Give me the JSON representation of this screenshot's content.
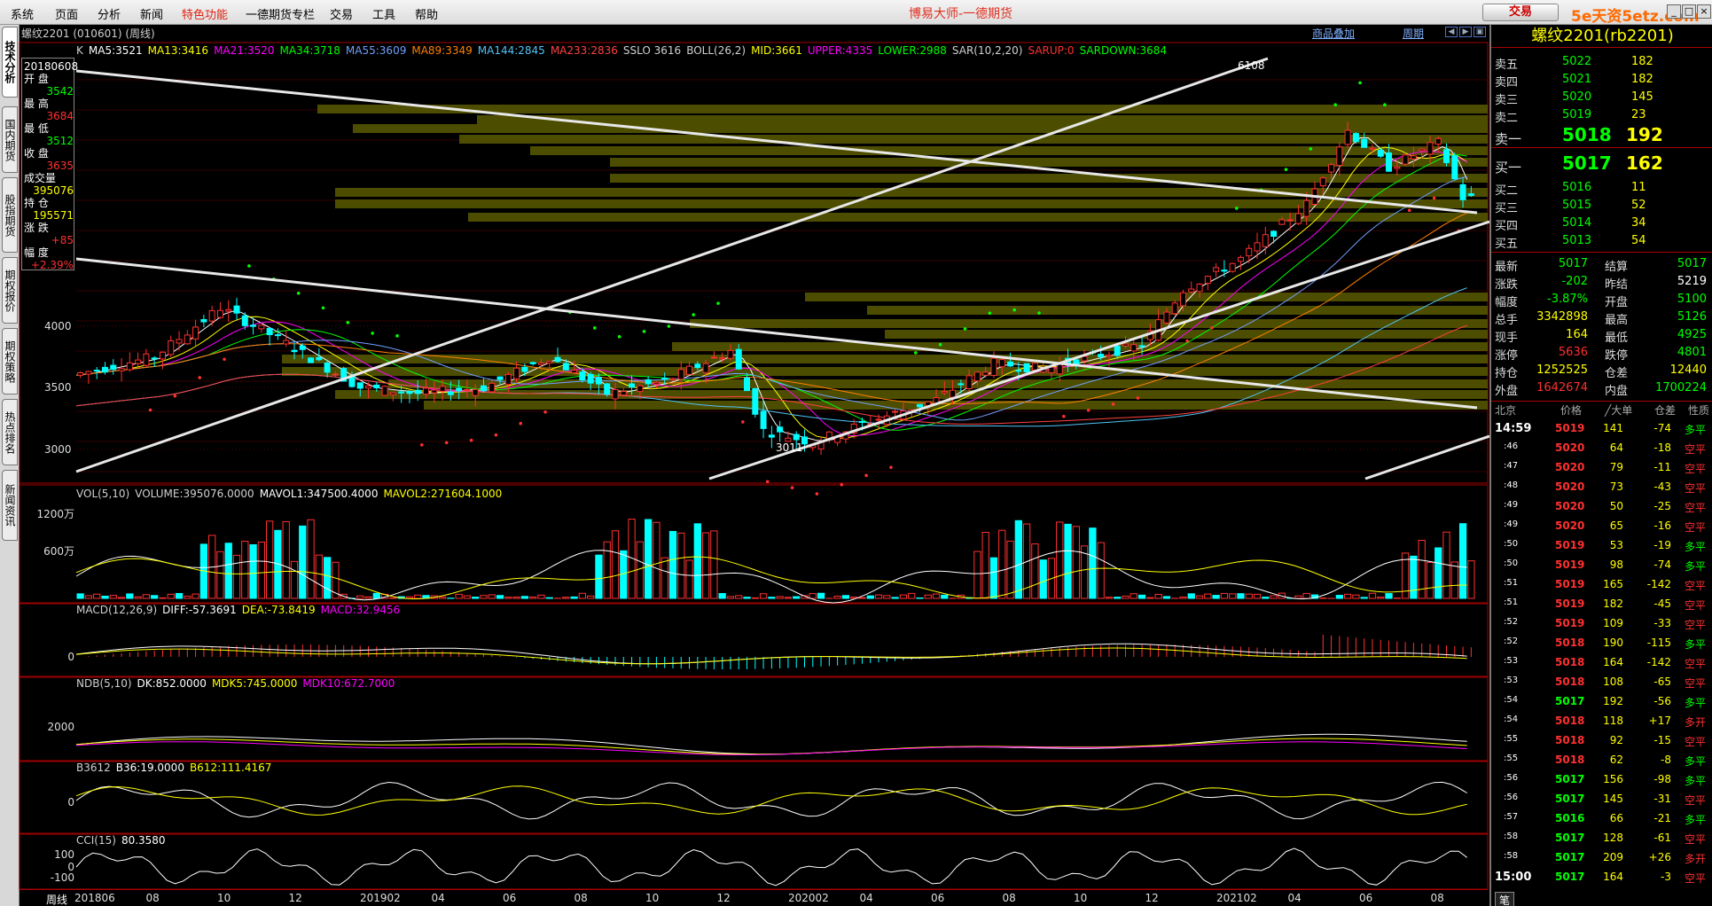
{
  "menu": [
    "系统",
    "页面",
    "分析",
    "新闻",
    "特色功能",
    "一德期货专栏",
    "交易",
    "工具",
    "帮助"
  ],
  "app_title": "博易大师-一德期货",
  "trade_button": "交易",
  "logo_text": "5e天资5etz.com",
  "window_controls": [
    "_",
    "□",
    "×"
  ],
  "left_tabs": [
    "技术分析",
    "国内期货",
    "股指期货",
    "期权报价",
    "期权策略",
    "热点排名",
    "新闻资讯"
  ],
  "contract_line": "螺纹2201 (010601) (周线)",
  "top_links": [
    "商品叠加",
    "周期"
  ],
  "main_indicator": [
    {
      "text": "K",
      "color": "#d0d0d0"
    },
    {
      "text": "MA5:3521",
      "color": "#ffffff"
    },
    {
      "text": "MA13:3416",
      "color": "#ffff00"
    },
    {
      "text": "MA21:3520",
      "color": "#ff00ff"
    },
    {
      "text": "MA34:3718",
      "color": "#00ff00"
    },
    {
      "text": "MA55:3609",
      "color": "#6f9fff"
    },
    {
      "text": "MA89:3349",
      "color": "#ff8000"
    },
    {
      "text": "MA144:2845",
      "color": "#4fc3f7"
    },
    {
      "text": "MA233:2836",
      "color": "#ff4040"
    },
    {
      "text": "SSLO 3616",
      "color": "#d0d0d0"
    },
    {
      "text": "BOLL(26,2)",
      "color": "#d0d0d0"
    },
    {
      "text": "MID:3661",
      "color": "#ffff00"
    },
    {
      "text": "UPPER:4335",
      "color": "#ff00ff"
    },
    {
      "text": "LOWER:2988",
      "color": "#00ff00"
    },
    {
      "text": "SAR(10,2,20)",
      "color": "#d0d0d0"
    },
    {
      "text": "SARUP:0",
      "color": "#ff3030"
    },
    {
      "text": "SARDOWN:3684",
      "color": "#00ff00"
    }
  ],
  "infobox": {
    "date": "20180608",
    "rows": [
      {
        "label": "开 盘",
        "value": "3542",
        "color": "#00ff00"
      },
      {
        "label": "最 高",
        "value": "3684",
        "color": "#ff3030"
      },
      {
        "label": "最 低",
        "value": "3512",
        "color": "#00ff00"
      },
      {
        "label": "收 盘",
        "value": "3635",
        "color": "#ff3030"
      },
      {
        "label": "成交量",
        "value": "395076",
        "color": "#ffff00"
      },
      {
        "label": "持 仓",
        "value": "195571",
        "color": "#ffff00"
      },
      {
        "label": "涨 跌",
        "value": "+85",
        "color": "#ff3030"
      },
      {
        "label": "幅 度",
        "value": "+2.39%",
        "color": "#ff3030"
      }
    ]
  },
  "price_axis": [
    "4000",
    "3500",
    "3000"
  ],
  "price_annotations": {
    "high": "6108",
    "low": "3011"
  },
  "vol_panel": {
    "header": [
      {
        "text": "VOL(5,10)",
        "color": "#d0d0d0"
      },
      {
        "text": "VOLUME:395076.0000",
        "color": "#d0d0d0"
      },
      {
        "text": "MAVOL1:347500.4000",
        "color": "#ffffff"
      },
      {
        "text": "MAVOL2:271604.1000",
        "color": "#ffff00"
      }
    ],
    "axis": [
      "1200万",
      "600万"
    ]
  },
  "macd_panel": {
    "header": [
      {
        "text": "MACD(12,26,9)",
        "color": "#d0d0d0"
      },
      {
        "text": "DIFF:-57.3691",
        "color": "#ffffff"
      },
      {
        "text": "DEA:-73.8419",
        "color": "#ffff00"
      },
      {
        "text": "MACD:32.9456",
        "color": "#ff00ff"
      }
    ],
    "axis": [
      "0"
    ]
  },
  "ndb_panel": {
    "header": [
      {
        "text": "NDB(5,10)",
        "color": "#d0d0d0"
      },
      {
        "text": "DK:852.0000",
        "color": "#ffffff"
      },
      {
        "text": "MDK5:745.0000",
        "color": "#ffff00"
      },
      {
        "text": "MDK10:672.7000",
        "color": "#ff00ff"
      }
    ],
    "axis": [
      "2000"
    ]
  },
  "b3612_panel": {
    "header": [
      {
        "text": "B3612",
        "color": "#d0d0d0"
      },
      {
        "text": "B36:19.0000",
        "color": "#ffffff"
      },
      {
        "text": "B612:111.4167",
        "color": "#ffff00"
      }
    ],
    "axis": [
      "0"
    ]
  },
  "cci_panel": {
    "header": [
      {
        "text": "CCI(15)",
        "color": "#d0d0d0"
      },
      {
        "text": "80.3580",
        "color": "#ffffff"
      }
    ],
    "axis": [
      "100",
      "0",
      "-100"
    ]
  },
  "x_axis": {
    "period": "周线",
    "labels": [
      "201806",
      "08",
      "10",
      "12",
      "201902",
      "04",
      "06",
      "08",
      "10",
      "12",
      "202002",
      "04",
      "06",
      "08",
      "10",
      "12",
      "202102",
      "04",
      "06",
      "08"
    ]
  },
  "quote": {
    "title": "螺纹2201(rb2201)",
    "asks": [
      {
        "label": "卖五",
        "price": "5022",
        "vol": "182"
      },
      {
        "label": "卖四",
        "price": "5021",
        "vol": "182"
      },
      {
        "label": "卖三",
        "price": "5020",
        "vol": "145"
      },
      {
        "label": "卖二",
        "price": "5019",
        "vol": "23"
      },
      {
        "label": "卖一",
        "price": "5018",
        "vol": "192"
      }
    ],
    "bids": [
      {
        "label": "买一",
        "price": "5017",
        "vol": "162"
      },
      {
        "label": "买二",
        "price": "5016",
        "vol": "11"
      },
      {
        "label": "买三",
        "price": "5015",
        "vol": "52"
      },
      {
        "label": "买四",
        "price": "5014",
        "vol": "34"
      },
      {
        "label": "买五",
        "price": "5013",
        "vol": "54"
      }
    ],
    "stats": [
      {
        "l1": "最新",
        "v1": "5017",
        "c1": "#00ff00",
        "l2": "结算",
        "v2": "5017",
        "c2": "#00ff00"
      },
      {
        "l1": "涨跌",
        "v1": "-202",
        "c1": "#00ff00",
        "l2": "昨结",
        "v2": "5219",
        "c2": "#ffffff"
      },
      {
        "l1": "幅度",
        "v1": "-3.87%",
        "c1": "#00ff00",
        "l2": "开盘",
        "v2": "5100",
        "c2": "#00ff00"
      },
      {
        "l1": "总手",
        "v1": "3342898",
        "c1": "#ffff00",
        "l2": "最高",
        "v2": "5126",
        "c2": "#00ff00"
      },
      {
        "l1": "现手",
        "v1": "164",
        "c1": "#ffff00",
        "l2": "最低",
        "v2": "4925",
        "c2": "#00ff00"
      },
      {
        "l1": "涨停",
        "v1": "5636",
        "c1": "#ff3030",
        "l2": "跌停",
        "v2": "4801",
        "c2": "#00ff00"
      },
      {
        "l1": "持仓",
        "v1": "1252525",
        "c1": "#ffff00",
        "l2": "仓差",
        "v2": "12440",
        "c2": "#ffff00"
      },
      {
        "l1": "外盘",
        "v1": "1642674",
        "c1": "#ff3030",
        "l2": "内盘",
        "v2": "1700224",
        "c2": "#00ff00"
      }
    ],
    "tick_header": [
      "北京",
      "价格",
      "╱大单",
      "仓差",
      "性质"
    ],
    "ticks": [
      {
        "t": "14:59",
        "p": "5019",
        "v": "141",
        "d": "-74",
        "n": "多平"
      },
      {
        "t": ":46",
        "p": "5020",
        "v": "64",
        "d": "-18",
        "n": "空平"
      },
      {
        "t": ":47",
        "p": "5020",
        "v": "79",
        "d": "-11",
        "n": "空平"
      },
      {
        "t": ":48",
        "p": "5020",
        "v": "73",
        "d": "-43",
        "n": "空平"
      },
      {
        "t": ":49",
        "p": "5020",
        "v": "50",
        "d": "-25",
        "n": "空平"
      },
      {
        "t": ":49",
        "p": "5020",
        "v": "65",
        "d": "-16",
        "n": "空平"
      },
      {
        "t": ":50",
        "p": "5019",
        "v": "53",
        "d": "-19",
        "n": "多平"
      },
      {
        "t": ":50",
        "p": "5019",
        "v": "98",
        "d": "-74",
        "n": "多平"
      },
      {
        "t": ":51",
        "p": "5019",
        "v": "165",
        "d": "-142",
        "n": "空平"
      },
      {
        "t": ":51",
        "p": "5019",
        "v": "182",
        "d": "-45",
        "n": "空平"
      },
      {
        "t": ":52",
        "p": "5019",
        "v": "109",
        "d": "-33",
        "n": "空平"
      },
      {
        "t": ":52",
        "p": "5018",
        "v": "190",
        "d": "-115",
        "n": "多平"
      },
      {
        "t": ":53",
        "p": "5018",
        "v": "164",
        "d": "-142",
        "n": "空平"
      },
      {
        "t": ":53",
        "p": "5018",
        "v": "108",
        "d": "-65",
        "n": "空平"
      },
      {
        "t": ":54",
        "p": "5017",
        "v": "192",
        "d": "-56",
        "n": "多平"
      },
      {
        "t": ":54",
        "p": "5018",
        "v": "118",
        "d": "+17",
        "n": "多开"
      },
      {
        "t": ":55",
        "p": "5018",
        "v": "92",
        "d": "-15",
        "n": "空平"
      },
      {
        "t": ":55",
        "p": "5018",
        "v": "62",
        "d": "-8",
        "n": "多平"
      },
      {
        "t": ":56",
        "p": "5017",
        "v": "156",
        "d": "-98",
        "n": "多平"
      },
      {
        "t": ":56",
        "p": "5017",
        "v": "145",
        "d": "-31",
        "n": "空平"
      },
      {
        "t": ":57",
        "p": "5016",
        "v": "66",
        "d": "-21",
        "n": "多平"
      },
      {
        "t": ":58",
        "p": "5017",
        "v": "128",
        "d": "-61",
        "n": "空平"
      },
      {
        "t": ":58",
        "p": "5017",
        "v": "209",
        "d": "+26",
        "n": "多开"
      },
      {
        "t": "15:00",
        "p": "5017",
        "v": "164",
        "d": "-3",
        "n": "空平"
      }
    ],
    "bottom_tab": "笔"
  }
}
